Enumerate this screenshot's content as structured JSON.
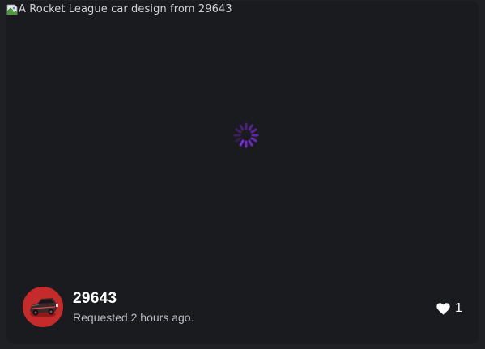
{
  "post": {
    "image_alt": "A Rocket League car design from 29643",
    "loading": true,
    "username": "29643",
    "timestamp": "Requested 2 hours ago.",
    "like_count": "1"
  },
  "icons": {
    "broken_image": "broken-image-icon",
    "spinner": "loading-spinner-icon",
    "avatar": "car-avatar",
    "like": "heart-icon"
  },
  "colors": {
    "page_bg": "#1f2023",
    "card_bg": "#1a1b1f",
    "spinner": "#7a2bd9",
    "avatar_bg": "#c62b2b",
    "text_primary": "#ffffff",
    "text_secondary": "#b9bbc0"
  }
}
